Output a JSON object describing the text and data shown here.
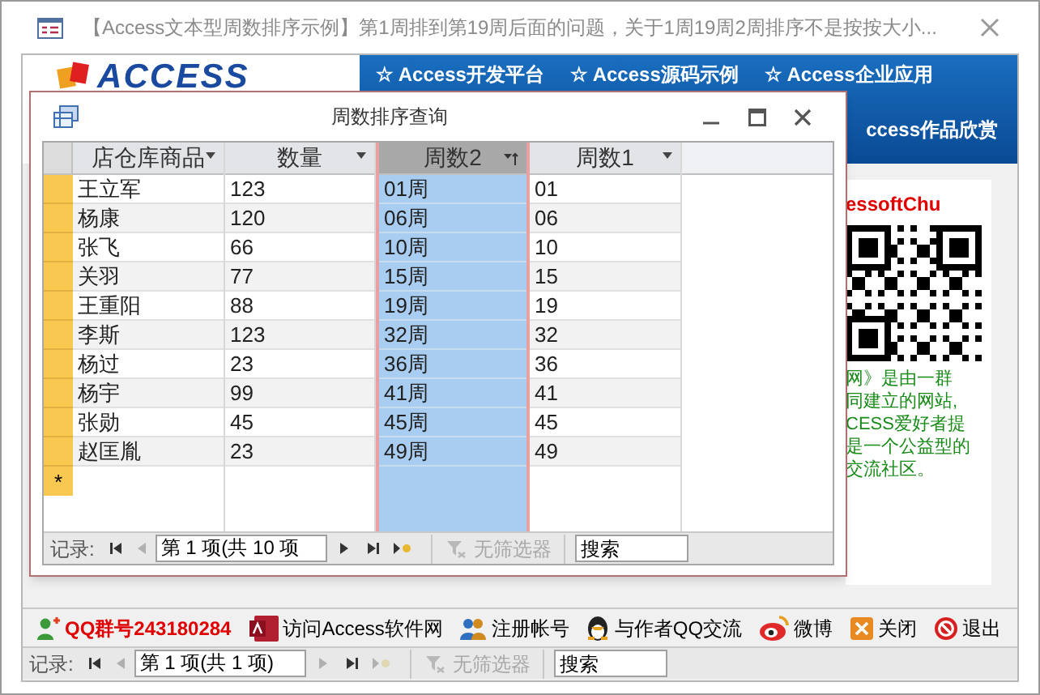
{
  "window": {
    "title": "【Access文本型周数排序示例】第1周排到第19周后面的问题，关于1周19周2周排序不是按按大小..."
  },
  "banner": {
    "logo": "ACCESS",
    "links": [
      "☆ Access开发平台",
      "☆ Access源码示例",
      "☆ Access企业应用"
    ],
    "second_row_link": "ccess作品欣赏"
  },
  "side_panel": {
    "heading": "essoftChu",
    "lines": [
      "网》是由一群",
      "同建立的网站,",
      "CESS爱好者提",
      "是一个公益型的",
      "交流社区。"
    ]
  },
  "dialog": {
    "title": "周数排序查询",
    "columns": [
      {
        "label": "店仓库商品",
        "selected": false,
        "sorted": false
      },
      {
        "label": "数量",
        "selected": false,
        "sorted": false
      },
      {
        "label": "周数2",
        "selected": true,
        "sorted": true
      },
      {
        "label": "周数1",
        "selected": false,
        "sorted": false
      }
    ],
    "rows": [
      [
        "王立军",
        "123",
        "01周",
        "01"
      ],
      [
        "杨康",
        "120",
        "06周",
        "06"
      ],
      [
        "张飞",
        "66",
        "10周",
        "10"
      ],
      [
        "关羽",
        "77",
        "15周",
        "15"
      ],
      [
        "王重阳",
        "88",
        "19周",
        "19"
      ],
      [
        "李斯",
        "123",
        "32周",
        "32"
      ],
      [
        "杨过",
        "23",
        "36周",
        "36"
      ],
      [
        "杨宇",
        "99",
        "41周",
        "41"
      ],
      [
        "张勋",
        "45",
        "45周",
        "45"
      ],
      [
        "赵匡胤",
        "23",
        "49周",
        "49"
      ]
    ],
    "new_row_marker": "*",
    "nav": {
      "label": "记录:",
      "position": "第 1 项(共 10 项",
      "buttons": [
        {
          "kind": "first",
          "disabled": false
        },
        {
          "kind": "prev",
          "disabled": true
        },
        {
          "kind": "next",
          "disabled": false
        },
        {
          "kind": "last",
          "disabled": false
        },
        {
          "kind": "new",
          "disabled": false
        }
      ],
      "filter": {
        "label": "无筛选器",
        "disabled": true
      },
      "search": {
        "placeholder": "搜索"
      }
    }
  },
  "toolbar": [
    {
      "kind": "qq-group",
      "label": "QQ群号243180284"
    },
    {
      "kind": "access",
      "label": "访问Access软件网"
    },
    {
      "kind": "users",
      "label": "注册帐号"
    },
    {
      "kind": "qq",
      "label": "与作者QQ交流"
    },
    {
      "kind": "weibo",
      "label": "微博"
    },
    {
      "kind": "close",
      "label": "关闭"
    },
    {
      "kind": "exit",
      "label": "退出"
    }
  ],
  "nav": {
    "label": "记录:",
    "position": "第 1 项(共 1 项)",
    "buttons": [
      {
        "kind": "first",
        "disabled": false
      },
      {
        "kind": "prev",
        "disabled": true
      },
      {
        "kind": "next",
        "disabled": true
      },
      {
        "kind": "last",
        "disabled": false
      },
      {
        "kind": "new",
        "disabled": true
      }
    ],
    "filter": {
      "label": "无筛选器",
      "disabled": true
    },
    "search": {
      "placeholder": "搜索"
    }
  }
}
